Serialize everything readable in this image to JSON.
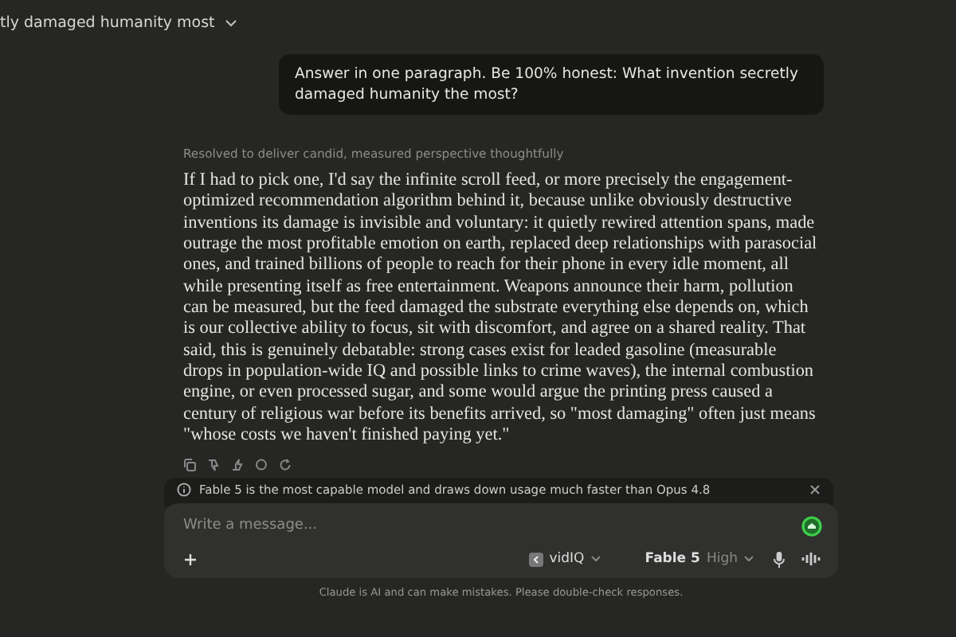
{
  "conversation_title": "tly damaged humanity most",
  "user_message": "Answer in one paragraph. Be 100% honest: What invention secretly damaged humanity the most?",
  "thinking_summary": "Resolved to deliver candid, measured perspective thoughtfully",
  "response": "If I had to pick one, I'd say the infinite scroll feed, or more precisely the engagement-optimized recommendation algorithm behind it, because unlike obviously destructive inventions its damage is invisible and voluntary: it quietly rewired attention spans, made outrage the most profitable emotion on earth, replaced deep relationships with parasocial ones, and trained billions of people to reach for their phone in every idle moment, all while presenting itself as free entertainment. Weapons announce their harm, pollution can be measured, but the feed damaged the substrate everything else depends on, which is our collective ability to focus, sit with discomfort, and agree on a shared reality. That said, this is genuinely debatable: strong cases exist for leaded gasoline (measurable drops in population-wide IQ and possible links to crime waves), the internal combustion engine, or even processed sugar, and some would argue the printing press caused a century of religious war before its benefits arrived, so \"most damaging\" often just means \"whose costs we haven't finished paying yet.\"",
  "notice": {
    "text": "Fable 5 is the most capable model and draws down usage much faster than Opus 4.8"
  },
  "composer": {
    "placeholder": "Write a message...",
    "tool": "vidIQ",
    "model": "Fable 5",
    "effort": "High"
  },
  "disclaimer": "Claude is AI and can make mistakes. Please double-check responses."
}
